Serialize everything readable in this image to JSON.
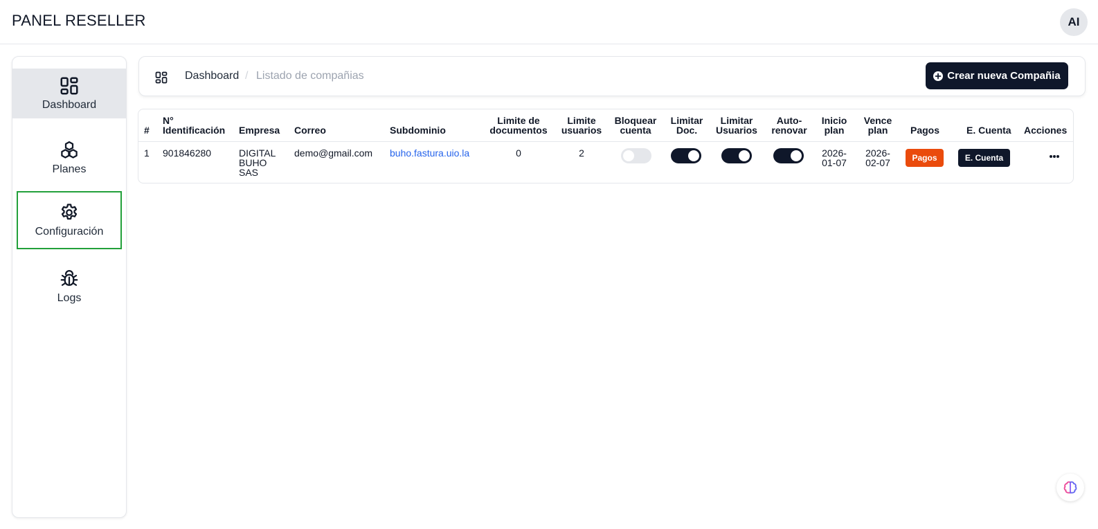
{
  "header": {
    "title": "PANEL RESELLER",
    "avatar_initials": "AI"
  },
  "sidebar": {
    "items": [
      {
        "label": "Dashboard",
        "icon": "dashboard-icon",
        "active": true
      },
      {
        "label": "Planes",
        "icon": "cubes-icon",
        "active": false
      },
      {
        "label": "Configuración",
        "icon": "gear-icon",
        "active": false,
        "focused": true
      },
      {
        "label": "Logs",
        "icon": "bug-icon",
        "active": false
      }
    ]
  },
  "breadcrumb": {
    "home": "Dashboard",
    "separator": "/",
    "current": "Listado de compañias",
    "create_button": "Crear nueva Compañia"
  },
  "table": {
    "columns": [
      "#",
      "N°\nIdentificación",
      "Empresa",
      "Correo",
      "Subdominio",
      "Limite de\ndocumentos",
      "Limite\nusuarios",
      "Bloquear\ncuenta",
      "Limitar\nDoc.",
      "Limitar\nUsuarios",
      "Auto-\nrenovar",
      "Inicio\nplan",
      "Vence\nplan",
      "Pagos",
      "E. Cuenta",
      "Acciones"
    ],
    "rows": [
      {
        "index": "1",
        "identificacion": "901846280",
        "empresa": "DIGITAL\nBUHO\nSAS",
        "correo": "demo@gmail.com",
        "subdominio": "buho.fastura.uio.la",
        "limite_documentos": "0",
        "limite_usuarios": "2",
        "bloquear_cuenta": false,
        "limitar_doc": true,
        "limitar_usuarios": true,
        "auto_renovar": true,
        "inicio_plan": "2026-\n01-07",
        "vence_plan": "2026-\n02-07",
        "pagos_label": "Pagos",
        "cuenta_label": "E. Cuenta"
      }
    ]
  },
  "colors": {
    "primary_dark": "#0f172a",
    "pagos_orange": "#ea4b0c",
    "link_blue": "#2563eb",
    "focus_green": "#22a03a"
  }
}
